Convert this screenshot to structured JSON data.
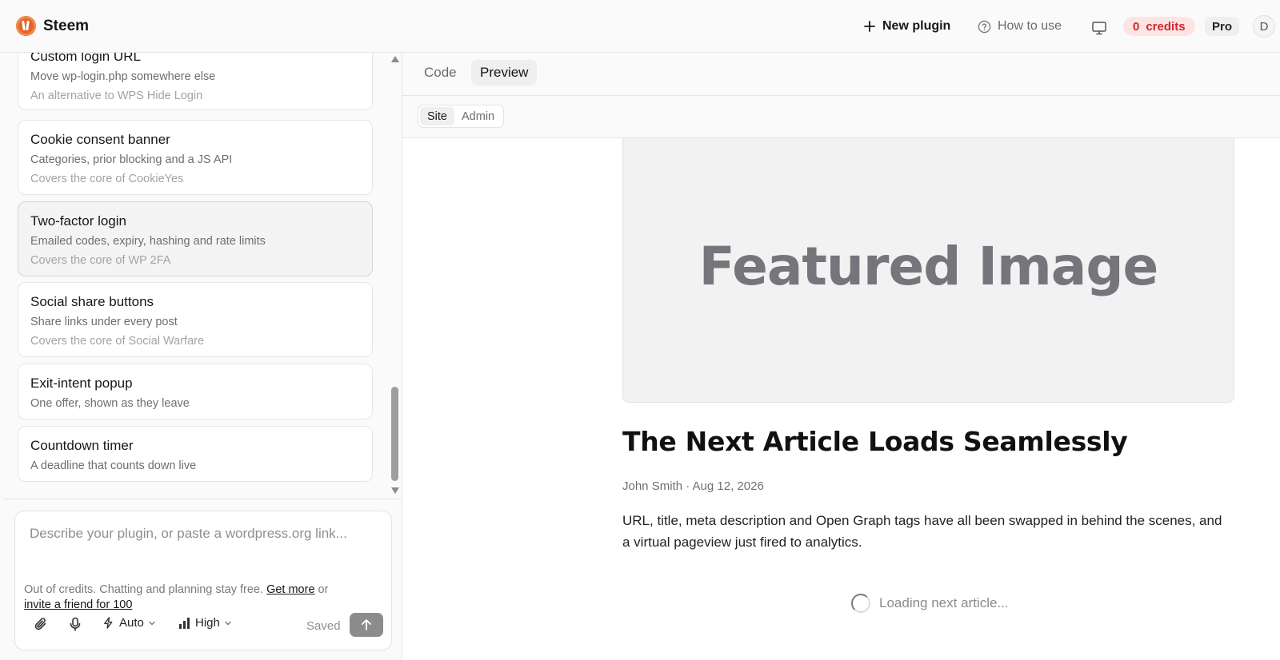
{
  "header": {
    "brand": "Steem",
    "new_plugin": "New plugin",
    "how_to_use": "How to use",
    "credits_count": "0",
    "credits_label": "credits",
    "plan": "Pro",
    "avatar_initial": "D"
  },
  "plugins": [
    {
      "title": "Custom login URL",
      "desc": "Move wp-login.php somewhere else",
      "note": "An alternative to WPS Hide Login"
    },
    {
      "title": "Cookie consent banner",
      "desc": "Categories, prior blocking and a JS API",
      "note": "Covers the core of CookieYes"
    },
    {
      "title": "Two-factor login",
      "desc": "Emailed codes, expiry, hashing and rate limits",
      "note": "Covers the core of WP 2FA",
      "active": true
    },
    {
      "title": "Social share buttons",
      "desc": "Share links under every post",
      "note": "Covers the core of Social Warfare"
    },
    {
      "title": "Exit-intent popup",
      "desc": "One offer, shown as they leave"
    },
    {
      "title": "Countdown timer",
      "desc": "A deadline that counts down live"
    }
  ],
  "composer": {
    "placeholder": "Describe your plugin, or paste a wordpress.org link...",
    "credit_text": "Out of credits. Chatting and planning stay free.",
    "get_more": "Get more",
    "or": "or",
    "invite": "invite a friend for 100",
    "mode": "Auto",
    "effort": "High",
    "saved": "Saved"
  },
  "tabs": {
    "code": "Code",
    "preview": "Preview",
    "site": "Site",
    "admin": "Admin"
  },
  "article": {
    "featured_image": "Featured Image",
    "title": "The Next Article Loads Seamlessly",
    "meta": "John Smith · Aug 12, 2026",
    "body": "URL, title, meta description and Open Graph tags have all been swapped in behind the scenes, and a virtual pageview just fired to analytics.",
    "loading": "Loading next article..."
  },
  "colors": {
    "brand": "#e4652a",
    "credits_bg": "#fde4e4",
    "credits_text": "#d5242b"
  },
  "icons": [
    "plus-icon",
    "help-circle-icon",
    "monitor-icon",
    "paperclip-icon",
    "microphone-icon",
    "lightning-icon",
    "signal-bars-icon",
    "chevron-down-icon",
    "arrow-up-icon",
    "spinner-icon"
  ]
}
